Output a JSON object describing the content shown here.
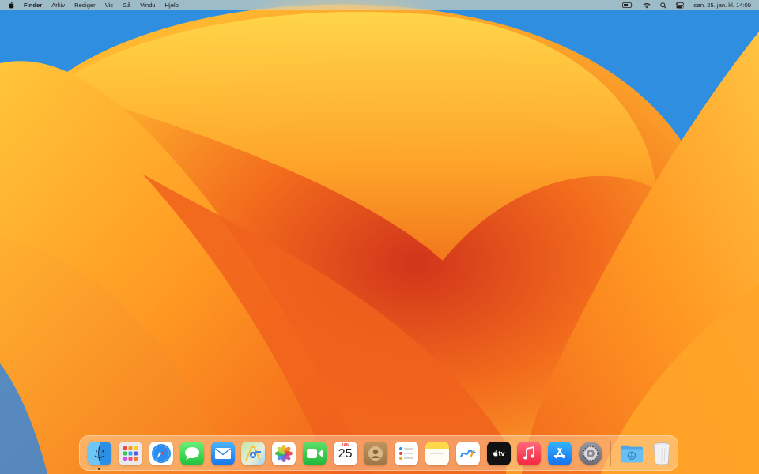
{
  "menubar": {
    "apple_menu": "apple-icon",
    "app_name": "Finder",
    "menus": [
      "Arkiv",
      "Rediger",
      "Vis",
      "Gå",
      "Vindu",
      "Hjelp"
    ],
    "status_icons": [
      "battery-icon",
      "wifi-icon",
      "spotlight-search-icon",
      "control-center-icon"
    ],
    "clock": "søn. 25. jan. kl. 14:09"
  },
  "wallpaper": {
    "name": "macOS Ventura"
  },
  "dock": {
    "apps": [
      {
        "name": "Finder",
        "icon": "finder-icon",
        "running": true
      },
      {
        "name": "Launchpad",
        "icon": "launchpad-icon"
      },
      {
        "name": "Safari",
        "icon": "safari-icon"
      },
      {
        "name": "Messages",
        "icon": "messages-icon"
      },
      {
        "name": "Mail",
        "icon": "mail-icon"
      },
      {
        "name": "Maps",
        "icon": "maps-icon"
      },
      {
        "name": "Photos",
        "icon": "photos-icon"
      },
      {
        "name": "FaceTime",
        "icon": "facetime-icon"
      },
      {
        "name": "Calendar",
        "icon": "calendar-icon"
      },
      {
        "name": "Contacts",
        "icon": "contacts-icon"
      },
      {
        "name": "Reminders",
        "icon": "reminders-icon"
      },
      {
        "name": "Notes",
        "icon": "notes-icon"
      },
      {
        "name": "Freeform",
        "icon": "freeform-icon"
      },
      {
        "name": "TV",
        "icon": "apple-tv-icon"
      },
      {
        "name": "Music",
        "icon": "music-icon"
      },
      {
        "name": "App Store",
        "icon": "app-store-icon"
      },
      {
        "name": "System Settings",
        "icon": "system-settings-icon"
      }
    ],
    "calendar": {
      "month": "JAN",
      "day": "25"
    },
    "tv_label": "tv",
    "others": [
      {
        "name": "Downloads",
        "icon": "downloads-folder-icon"
      },
      {
        "name": "Trash",
        "icon": "trash-icon"
      }
    ]
  }
}
